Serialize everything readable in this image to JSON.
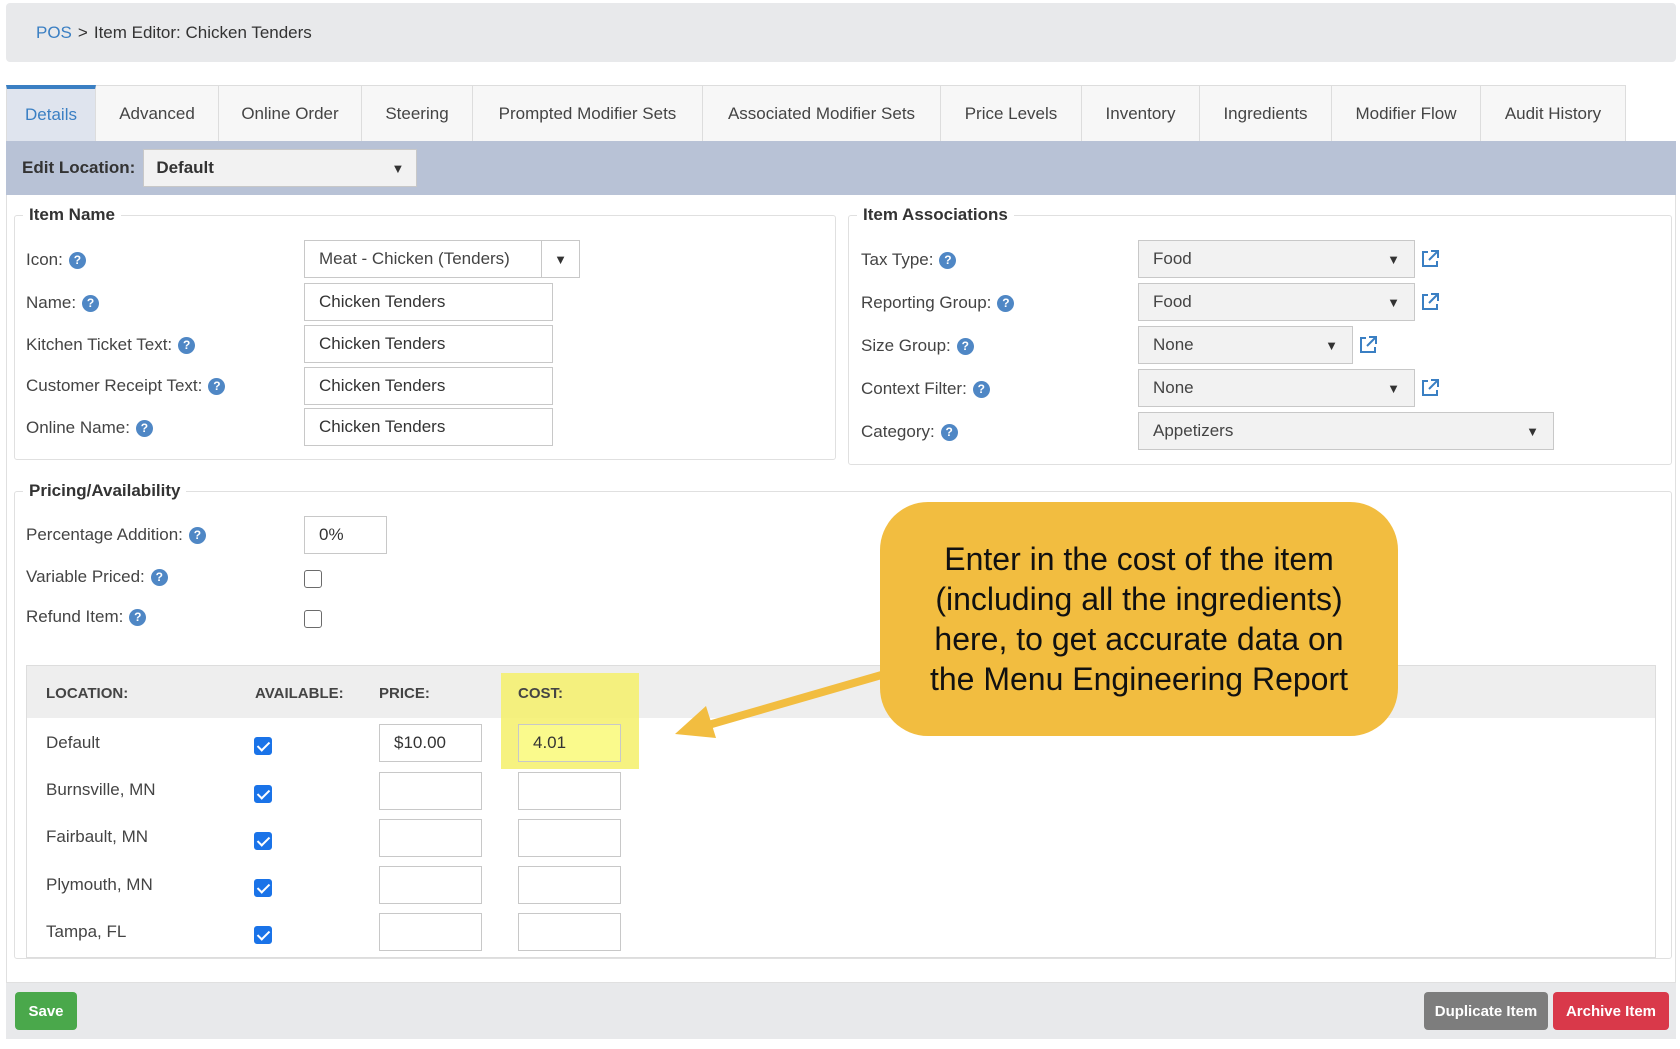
{
  "breadcrumb": {
    "root": "POS",
    "separator": ">",
    "current": "Item Editor: Chicken Tenders"
  },
  "tabs": [
    {
      "label": "Details",
      "active": true
    },
    {
      "label": "Advanced"
    },
    {
      "label": "Online Order"
    },
    {
      "label": "Steering"
    },
    {
      "label": "Prompted Modifier Sets"
    },
    {
      "label": "Associated Modifier Sets"
    },
    {
      "label": "Price Levels"
    },
    {
      "label": "Inventory"
    },
    {
      "label": "Ingredients"
    },
    {
      "label": "Modifier Flow"
    },
    {
      "label": "Audit History"
    }
  ],
  "edit_location": {
    "label": "Edit Location:",
    "value": "Default"
  },
  "item_name": {
    "legend": "Item Name",
    "icon_label": "Icon:",
    "icon_value": "Meat - Chicken (Tenders)",
    "name_label": "Name:",
    "name_value": "Chicken Tenders",
    "kitchen_label": "Kitchen Ticket Text:",
    "kitchen_value": "Chicken Tenders",
    "receipt_label": "Customer Receipt Text:",
    "receipt_value": "Chicken Tenders",
    "online_label": "Online Name:",
    "online_value": "Chicken Tenders"
  },
  "item_associations": {
    "legend": "Item Associations",
    "tax_label": "Tax Type:",
    "tax_value": "Food",
    "reporting_label": "Reporting Group:",
    "reporting_value": "Food",
    "size_label": "Size Group:",
    "size_value": "None",
    "context_label": "Context Filter:",
    "context_value": "None",
    "category_label": "Category:",
    "category_value": "Appetizers"
  },
  "pricing": {
    "legend": "Pricing/Availability",
    "pct_label": "Percentage Addition:",
    "pct_value": "0%",
    "variable_label": "Variable Priced:",
    "variable_checked": false,
    "refund_label": "Refund Item:",
    "refund_checked": false
  },
  "locations_table": {
    "headers": {
      "location": "LOCATION:",
      "available": "AVAILABLE:",
      "price": "PRICE:",
      "cost": "COST:"
    },
    "rows": [
      {
        "location": "Default",
        "available": true,
        "price": "$10.00",
        "cost": "4.01"
      },
      {
        "location": "Burnsville, MN",
        "available": true,
        "price": "",
        "cost": ""
      },
      {
        "location": "Fairbault, MN",
        "available": true,
        "price": "",
        "cost": ""
      },
      {
        "location": "Plymouth, MN",
        "available": true,
        "price": "",
        "cost": ""
      },
      {
        "location": "Tampa, FL",
        "available": true,
        "price": "",
        "cost": ""
      }
    ]
  },
  "buttons": {
    "save": "Save",
    "duplicate": "Duplicate Item",
    "archive": "Archive Item"
  },
  "callout": {
    "text": "Enter in the cost of the item (including all the ingredients) here, to get accurate data on the Menu Engineering Report"
  },
  "colors": {
    "accent": "#3a7fc3",
    "callout": "#f2bd40",
    "highlight": "#f5f06a",
    "save": "#4aa84b",
    "archive": "#d9394a",
    "duplicate": "#7d7d7d"
  },
  "icons": {
    "help": "question-circle-icon",
    "external": "external-link-icon",
    "dropdown": "caret-down-icon"
  }
}
